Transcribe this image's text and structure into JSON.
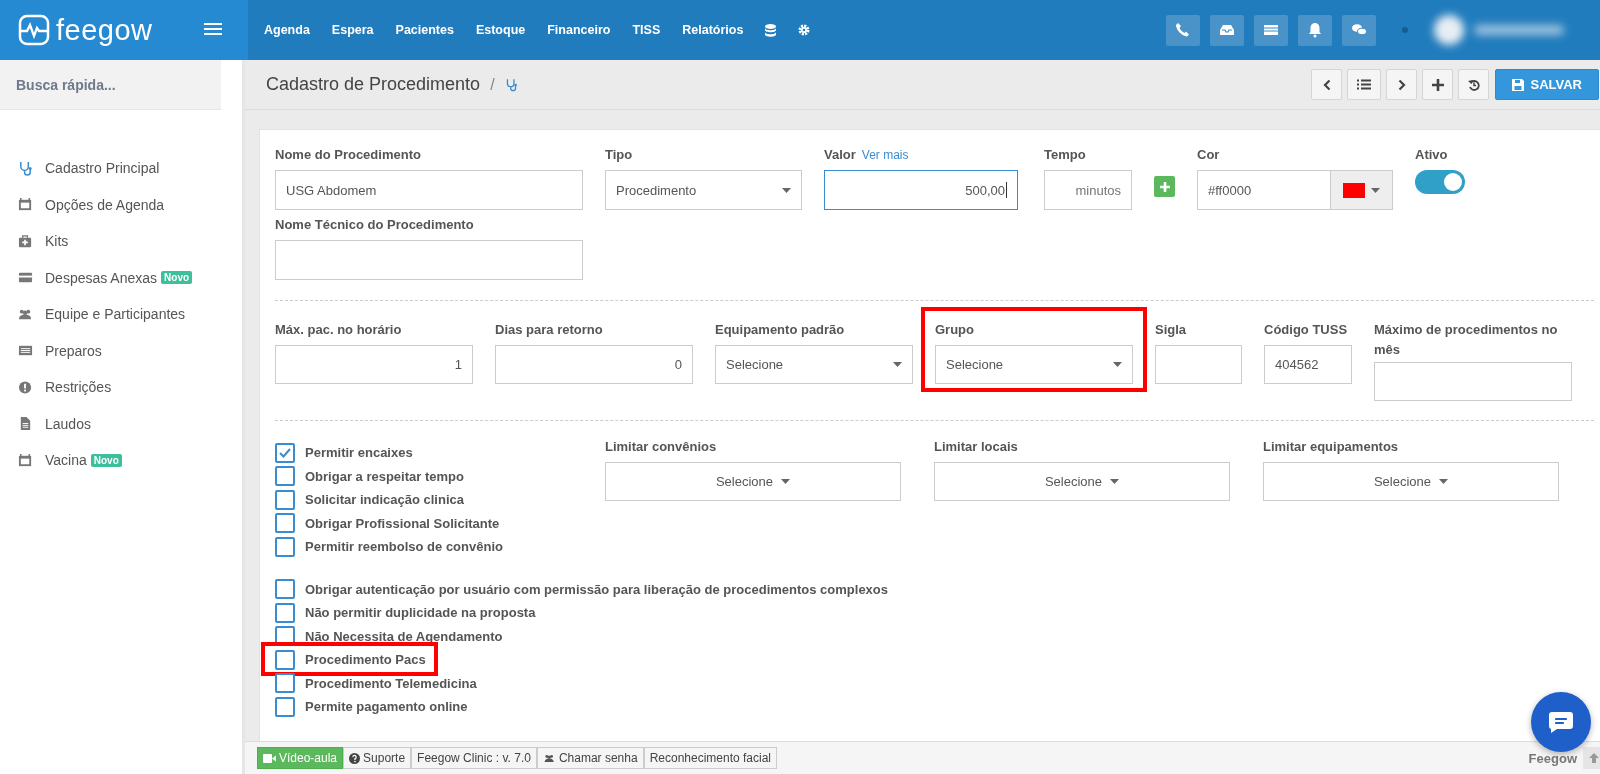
{
  "brand": {
    "name": "feegow"
  },
  "nav": [
    "Agenda",
    "Espera",
    "Pacientes",
    "Estoque",
    "Financeiro",
    "TISS",
    "Relatórios"
  ],
  "sidebar": {
    "search_placeholder": "Busca rápida...",
    "items": [
      {
        "label": "Cadastro Principal",
        "selected": true
      },
      {
        "label": "Opções de Agenda",
        "selected": false
      },
      {
        "label": "Kits",
        "selected": false
      },
      {
        "label": "Despesas Anexas",
        "selected": false,
        "badge": "Novo"
      },
      {
        "label": "Equipe e Participantes",
        "selected": false
      },
      {
        "label": "Preparos",
        "selected": false
      },
      {
        "label": "Restrições",
        "selected": false
      },
      {
        "label": "Laudos",
        "selected": false
      },
      {
        "label": "Vacina",
        "selected": false,
        "badge": "Novo"
      }
    ]
  },
  "page": {
    "title": "Cadastro de Procedimento",
    "separator": "/",
    "save_label": "SALVAR"
  },
  "form": {
    "nome": {
      "label": "Nome do Procedimento",
      "value": "USG Abdomem"
    },
    "tipo": {
      "label": "Tipo",
      "value": "Procedimento"
    },
    "valor": {
      "label": "Valor",
      "link": "Ver mais",
      "value": "500,00",
      "focused": true
    },
    "tempo": {
      "label": "Tempo",
      "placeholder": "minutos"
    },
    "cor": {
      "label": "Cor",
      "value": "#ff0000",
      "color": "#ff0000"
    },
    "ativo": {
      "label": "Ativo",
      "on": true
    },
    "nome_tecnico": {
      "label": "Nome Técnico do Procedimento"
    },
    "row2": [
      {
        "kind": "number",
        "label": "Máx. pac. no horário",
        "value": "1",
        "highlighted": false
      },
      {
        "kind": "number",
        "label": "Dias para retorno",
        "value": "0",
        "highlighted": false
      },
      {
        "kind": "select",
        "label": "Equipamento padrão",
        "value": "Selecione",
        "highlighted": false
      },
      {
        "kind": "select",
        "label": "Grupo",
        "value": "Selecione",
        "highlighted": true
      },
      {
        "kind": "text",
        "label": "Sigla",
        "highlighted": false
      },
      {
        "kind": "text",
        "label": "Código TUSS",
        "value": "404562",
        "highlighted": false
      },
      {
        "kind": "text",
        "label": "Máximo de procedimentos no mês",
        "highlighted": false
      }
    ],
    "checks_1": [
      {
        "label": "Permitir encaixes",
        "checked": true,
        "highlighted": false
      },
      {
        "label": "Obrigar a respeitar tempo",
        "checked": false,
        "highlighted": false
      },
      {
        "label": "Solicitar indicação clinica",
        "checked": false,
        "highlighted": false
      },
      {
        "label": "Obrigar Profissional Solicitante",
        "checked": false,
        "highlighted": false
      },
      {
        "label": "Permitir reembolso de convênio",
        "checked": false,
        "highlighted": false
      }
    ],
    "checks_2": [
      {
        "label": "Obrigar autenticação por usuário com permissão para liberação de procedimentos complexos",
        "checked": false,
        "highlighted": false
      },
      {
        "label": "Não permitir duplicidade na proposta",
        "checked": false,
        "highlighted": false
      },
      {
        "label": "Não Necessita de Agendamento",
        "checked": false,
        "highlighted": false
      },
      {
        "label": "Procedimento Pacs",
        "checked": false,
        "highlighted": true
      },
      {
        "label": "Procedimento Telemedicina",
        "checked": false,
        "highlighted": false
      },
      {
        "label": "Permite pagamento online",
        "checked": false,
        "highlighted": false
      }
    ],
    "limits": [
      {
        "label": "Limitar convênios",
        "value": "Selecione"
      },
      {
        "label": "Limitar locais",
        "value": "Selecione"
      },
      {
        "label": "Limitar equipamentos",
        "value": "Selecione"
      }
    ]
  },
  "footer": {
    "buttons": [
      {
        "kind": "video",
        "label": "Vídeo-aula"
      },
      {
        "kind": "help",
        "label": "Suporte"
      },
      {
        "kind": "plain",
        "label": "Feegow Clinic : v. 7.0"
      },
      {
        "kind": "users",
        "label": "Chamar senha"
      },
      {
        "kind": "plain",
        "label": "Reconhecimento facial"
      }
    ],
    "brand": "Feegow"
  }
}
